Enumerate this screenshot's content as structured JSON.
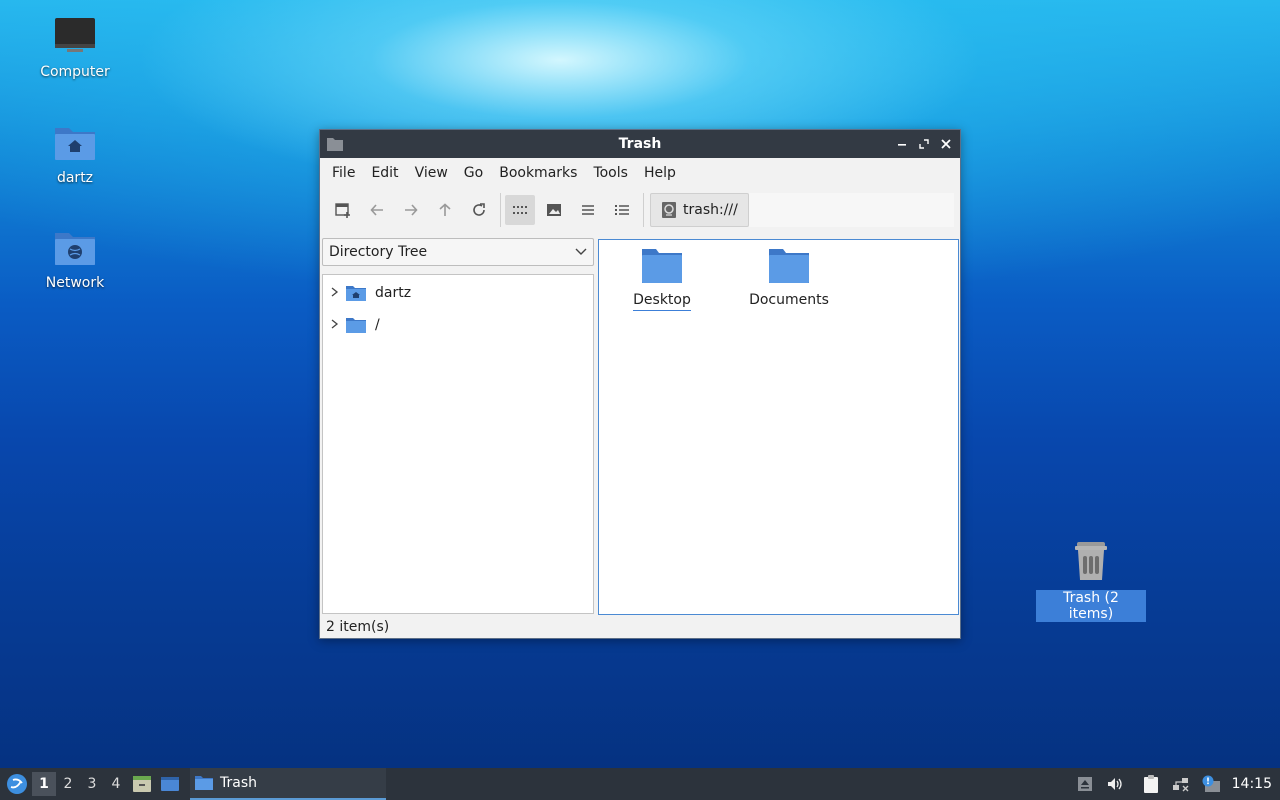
{
  "desktop": {
    "icons": [
      {
        "label": "Computer",
        "icon": "computer-icon"
      },
      {
        "label": "dartz",
        "icon": "home-folder-icon"
      },
      {
        "label": "Network",
        "icon": "network-folder-icon"
      },
      {
        "label": "Trash (2 items)",
        "icon": "trash-icon"
      }
    ]
  },
  "window": {
    "title": "Trash",
    "menu": [
      "File",
      "Edit",
      "View",
      "Go",
      "Bookmarks",
      "Tools",
      "Help"
    ],
    "toolbar": {
      "icons": [
        "new-tab-icon",
        "back-arrow-icon",
        "forward-arrow-icon",
        "up-arrow-icon",
        "reload-icon",
        "icon-view-icon",
        "thumbnail-view-icon",
        "compact-view-icon",
        "detailed-list-view-icon"
      ],
      "active_view": "icon-view",
      "path": "trash:///"
    },
    "side_panel": {
      "selector": "Directory Tree",
      "tree": [
        {
          "name": "dartz",
          "icon": "home-folder-icon"
        },
        {
          "name": "/",
          "icon": "folder-icon"
        }
      ]
    },
    "files": [
      {
        "name": "Desktop",
        "icon": "folder-icon"
      },
      {
        "name": "Documents",
        "icon": "folder-icon"
      }
    ],
    "status": "2 item(s)"
  },
  "taskbar": {
    "workspaces": [
      "1",
      "2",
      "3",
      "4"
    ],
    "active_workspace": "1",
    "task": "Trash",
    "clock": "14:15"
  },
  "colors": {
    "accent": "#3c7fd8",
    "titlebar": "#333a44",
    "taskbar": "#2c333c",
    "folder": "#4a87d6"
  }
}
